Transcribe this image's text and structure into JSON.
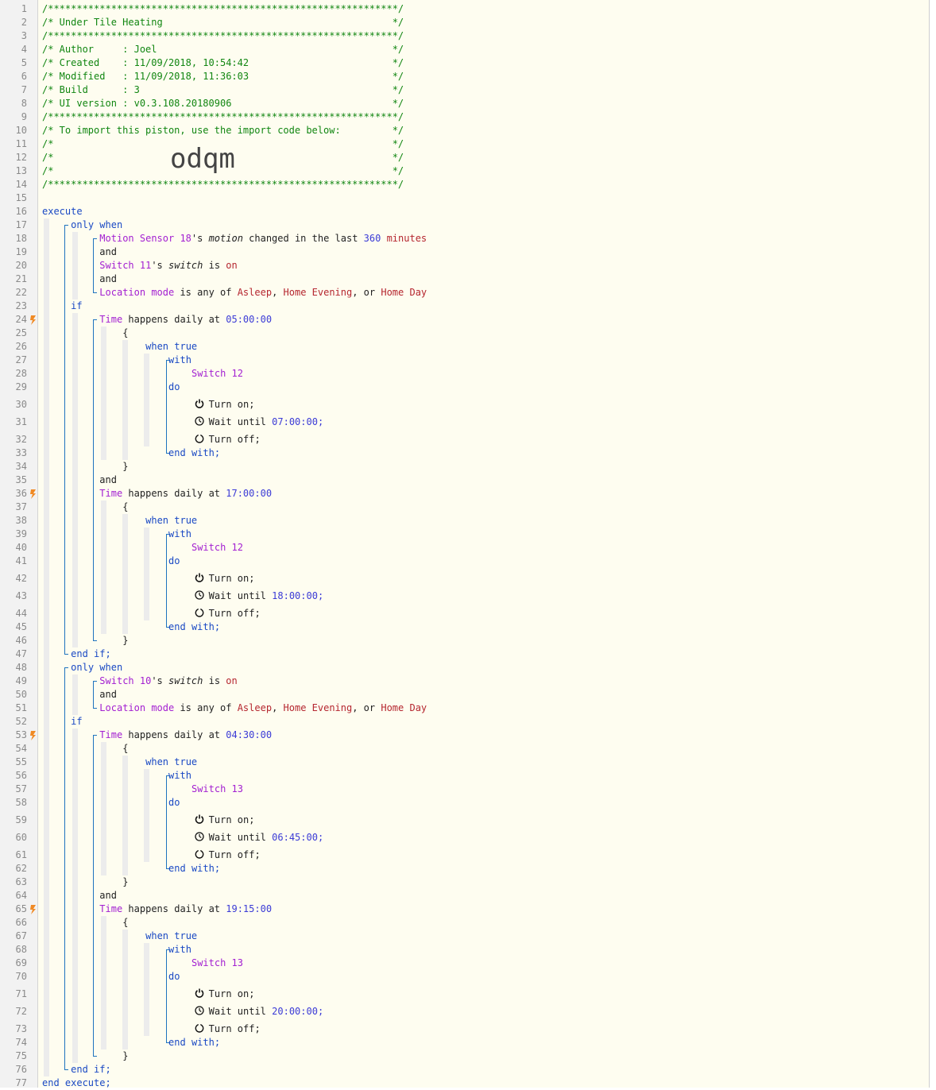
{
  "header": {
    "line1": "/*************************************************************/",
    "line2": "/* Under Tile Heating                                        */",
    "line3": "/*************************************************************/",
    "line4": "/* Author     : Joel                                         */",
    "line5": "/* Created    : 11/09/2018, 10:54:42                         */",
    "line6": "/* Modified   : 11/09/2018, 11:36:03                         */",
    "line7": "/* Build      : 3                                            */",
    "line8": "/* UI version : v0.3.108.20180906                            */",
    "line9": "/*************************************************************/",
    "line10": "/* To import this piston, use the import code below:         */",
    "line11": "/*                                                           */",
    "line12": "/*                                                           */",
    "line13": "/*                                                           */",
    "line14": "/*************************************************************/",
    "import_code": "odqm"
  },
  "code": {
    "execute": "execute",
    "only_when": "only when",
    "and": "and",
    "if": "if",
    "end_if": "end if;",
    "end_execute": "end execute;",
    "motion_sensor": "Motion Sensor 18",
    "motion_suffix": "'s ",
    "motion_attr": "motion",
    "motion_changed": " changed in the last ",
    "motion_minutes_val": "360",
    "motion_minutes_unit": " minutes",
    "switch11": "Switch 11",
    "switch10": "Switch 10",
    "switch_attr": "switch",
    "is": " is ",
    "on": "on",
    "location_mode": "Location mode",
    "is_any_of": " is any of ",
    "mode1": "Asleep",
    "mode2": "Home Evening",
    "mode3": "Home Day",
    "comma": ", ",
    "or": ", or ",
    "time": "Time",
    "happens_daily": " happens daily at ",
    "open_brace": "{",
    "close_brace": "}",
    "when_true": "when true",
    "with": "with",
    "do": "do",
    "turn_on": "Turn on;",
    "wait_until": "Wait until ",
    "turn_off": "Turn off;",
    "end_with": "end with;",
    "blocks": [
      {
        "time": "05:00:00",
        "device": "Switch 12",
        "wait": "07:00:00;"
      },
      {
        "time": "17:00:00",
        "device": "Switch 12",
        "wait": "18:00:00;"
      },
      {
        "time": "04:30:00",
        "device": "Switch 13",
        "wait": "06:45:00;"
      },
      {
        "time": "19:15:00",
        "device": "Switch 13",
        "wait": "20:00:00;"
      }
    ]
  },
  "colors": {
    "comment": "#118611",
    "device": "#a31fd1",
    "value": "#3b3bd6",
    "string": "#b5262f",
    "keyword": "#1a49c4",
    "background": "#fefdf0"
  },
  "icons": [
    "power-icon",
    "clock-icon",
    "power-off-icon",
    "event-flag-icon"
  ]
}
